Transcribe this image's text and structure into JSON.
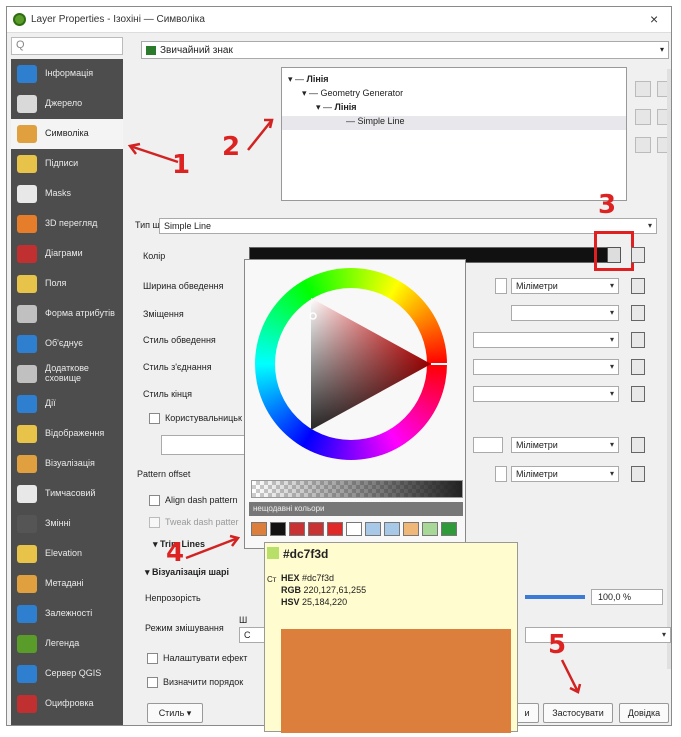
{
  "window": {
    "title": "Layer Properties - Ізохіні — Символіка",
    "close_glyph": "×"
  },
  "search": {
    "placeholder": "Q"
  },
  "sidebar": {
    "items": [
      {
        "label": "Інформація",
        "icon": "info-icon",
        "color": "#2f7fd1"
      },
      {
        "label": "Джерело",
        "icon": "source-icon",
        "color": "#d9d9d9"
      },
      {
        "label": "Символіка",
        "icon": "paintbrush-icon",
        "color": "#e0a040"
      },
      {
        "label": "Підписи",
        "icon": "labels-icon",
        "color": "#e8c34a"
      },
      {
        "label": "Masks",
        "icon": "masks-icon",
        "color": "#e8e8e8"
      },
      {
        "label": "3D перегляд",
        "icon": "cube-icon",
        "color": "#e67d2b"
      },
      {
        "label": "Діаграми",
        "icon": "diagram-icon",
        "color": "#c03030"
      },
      {
        "label": "Поля",
        "icon": "fields-icon",
        "color": "#e8c34a"
      },
      {
        "label": "Форма атрибутів",
        "icon": "form-icon",
        "color": "#c0c0c0"
      },
      {
        "label": "Об'єднує",
        "icon": "join-icon",
        "color": "#2f7fd1"
      },
      {
        "label": "Додаткове сховище",
        "icon": "storage-icon",
        "color": "#c0c0c0"
      },
      {
        "label": "Дії",
        "icon": "gear-icon",
        "color": "#2f7fd1"
      },
      {
        "label": "Відображення",
        "icon": "display-icon",
        "color": "#e8c34a"
      },
      {
        "label": "Візуалізація",
        "icon": "rendering-icon",
        "color": "#e0a040"
      },
      {
        "label": "Тимчасовий",
        "icon": "clock-icon",
        "color": "#e8e8e8"
      },
      {
        "label": "Змінні",
        "icon": "variables-icon",
        "color": "#555555"
      },
      {
        "label": "Elevation",
        "icon": "elevation-icon",
        "color": "#e8c34a"
      },
      {
        "label": "Метадані",
        "icon": "metadata-icon",
        "color": "#e0a040"
      },
      {
        "label": "Залежності",
        "icon": "dependencies-icon",
        "color": "#2f7fd1"
      },
      {
        "label": "Легенда",
        "icon": "legend-icon",
        "color": "#5a9c2a"
      },
      {
        "label": "Сервер QGIS",
        "icon": "server-icon",
        "color": "#2f7fd1"
      },
      {
        "label": "Оцифровка",
        "icon": "digitize-icon",
        "color": "#c03030"
      }
    ]
  },
  "renderer": {
    "label": "Звичайний знак"
  },
  "tree": {
    "items": [
      "Лінія",
      "Geometry Generator",
      "Лінія",
      "Simple Line"
    ],
    "toggle_glyph": "▾"
  },
  "props": {
    "symbol_type_label": "Тип шару",
    "symbol_type_value": "Simple Line",
    "color_label": "Колір",
    "stroke_width_label": "Ширина обведення",
    "offset_label": "Зміщення",
    "stroke_style_label": "Стиль обведення",
    "join_style_label": "Стиль з'єднання",
    "cap_style_label": "Стиль кінця",
    "custom_dash_label": "Користувальницьк",
    "pattern_offset_label": "Pattern offset",
    "align_dash_label": "Align dash pattern",
    "tweak_dash_label": "Tweak dash patter",
    "trim_lines_label": "Trim Lines",
    "units": "Міліметри",
    "layer_rendering_label": "Візуалізація шарі",
    "opacity_label": "Непрозорість",
    "opacity_value": "100,0 %",
    "blend_mode_label": "Режим змішування",
    "blend_partial": "Ш",
    "blend_value_partial": "С",
    "draw_effects_label": "Налаштувати ефект",
    "control_order_label": "Визначити порядок",
    "style_label": "Стиль"
  },
  "picker": {
    "recent_label": "нещодавні кольори",
    "swatches": [
      "#dc7f3d",
      "#111111",
      "#c83232",
      "#c83232",
      "#e02828",
      "#ffffff",
      "#a8c8e8",
      "#a8c8e8",
      "#f0b878",
      "#a8d898",
      "#2e9a3a"
    ]
  },
  "tooltip": {
    "hex_title": "#dc7f3d",
    "hex_label": "HEX",
    "hex_value": "#dc7f3d",
    "rgb_label": "RGB",
    "rgb_value": "220,127,61,255",
    "hsv_label": "HSV",
    "hsv_value": "25,184,220",
    "color": "#dc7f3d",
    "small_chip_color": "#b8e068",
    "partial_label": "Ст"
  },
  "buttons": {
    "apply": "Застосувати",
    "help": "Довідка",
    "ok_partial": "и"
  },
  "annotations": [
    "1",
    "2",
    "3",
    "4",
    "5"
  ],
  "colors": {
    "annotation_red": "#d22222",
    "sidebar_bg": "#4d4d4d"
  }
}
